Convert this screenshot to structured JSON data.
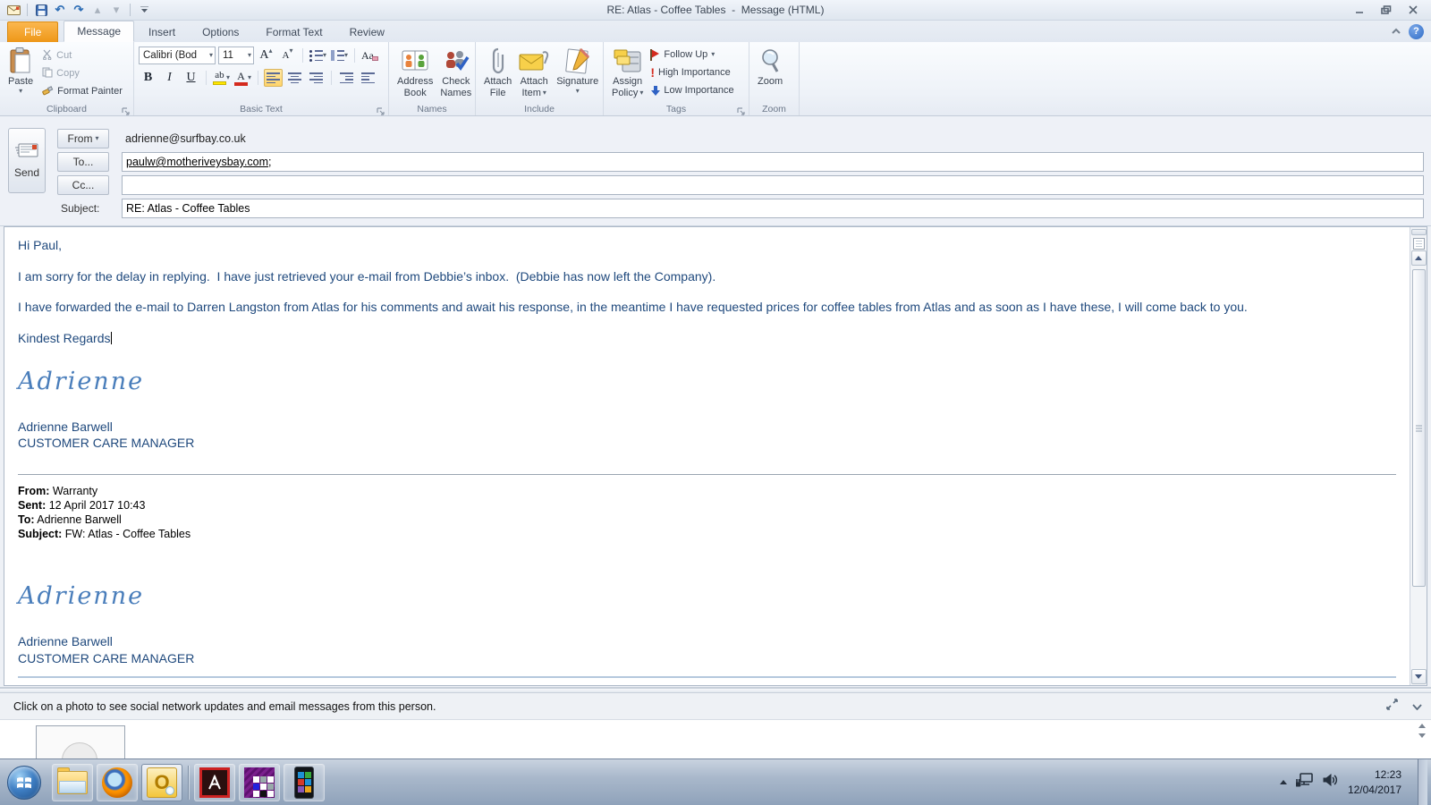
{
  "window": {
    "title": "RE: Atlas - Coffee Tables  -  Message (HTML)"
  },
  "tabs": {
    "file": "File",
    "items": [
      {
        "label": "Message",
        "active": true
      },
      {
        "label": "Insert",
        "active": false
      },
      {
        "label": "Options",
        "active": false
      },
      {
        "label": "Format Text",
        "active": false
      },
      {
        "label": "Review",
        "active": false
      }
    ]
  },
  "ribbon": {
    "clipboard": {
      "label": "Clipboard",
      "paste": "Paste",
      "cut": "Cut",
      "copy": "Copy",
      "format_painter": "Format Painter"
    },
    "basic_text": {
      "label": "Basic Text",
      "font_name": "Calibri (Bod",
      "font_size": "11"
    },
    "names": {
      "label": "Names",
      "address_book_1": "Address",
      "address_book_2": "Book",
      "check_names_1": "Check",
      "check_names_2": "Names"
    },
    "include": {
      "label": "Include",
      "attach_file_1": "Attach",
      "attach_file_2": "File",
      "attach_item_1": "Attach",
      "attach_item_2": "Item",
      "signature": "Signature"
    },
    "tags": {
      "label": "Tags",
      "assign_policy_1": "Assign",
      "assign_policy_2": "Policy",
      "follow_up": "Follow Up",
      "high_importance": "High Importance",
      "low_importance": "Low Importance"
    },
    "zoom": {
      "label": "Zoom",
      "zoom": "Zoom"
    }
  },
  "header": {
    "send": "Send",
    "from_label": "From",
    "from_value": "adrienne@surfbay.co.uk",
    "to_label": "To...",
    "to_value": "paulw@motheriveysbay.com",
    "to_suffix": ";",
    "cc_label": "Cc...",
    "cc_value": "",
    "subject_label": "Subject:",
    "subject_value": "RE: Atlas - Coffee Tables"
  },
  "body": {
    "greeting": "Hi Paul,",
    "p1": "I am sorry for the delay in replying.  I have just retrieved your e-mail from Debbie’s inbox.  (Debbie has now left the Company).",
    "p2": "I have forwarded the e-mail to Darren Langston from Atlas for his comments and await his response, in the meantime I have requested prices for coffee tables from Atlas and as soon as I have these, I will come back to you.",
    "closing": "Kindest Regards",
    "signature_script": "Adrienne",
    "signature_name": "Adrienne Barwell",
    "signature_role": "CUSTOMER CARE MANAGER",
    "quoted": {
      "from_label": "From:",
      "from": " Warranty",
      "sent_label": "Sent:",
      "sent": " 12 April 2017 10:43",
      "to_label": "To:",
      "to": " Adrienne Barwell",
      "subject_label": "Subject:",
      "subject": " FW: Atlas - Coffee Tables"
    }
  },
  "people_pane": {
    "hint": "Click on a photo to see social network updates and email messages from this person."
  },
  "taskbar": {
    "time": "12:23",
    "date": "12/04/2017"
  },
  "icons": {
    "caret": "▾",
    "undo": "↶",
    "redo": "↷",
    "nav_up": "▴",
    "nav_down": "▾",
    "bold": "B",
    "italic": "I",
    "underline": "U",
    "grow_font": "A",
    "shrink_font": "A",
    "clear_format": "Aa",
    "highlight": "ab",
    "font_color": "A",
    "high_importance_glyph": "!",
    "question": "?",
    "outlook_letter": "O"
  },
  "colors": {
    "accent_orange": "#ee9718",
    "body_blue": "#1f497d",
    "script_blue": "#4a7ebb",
    "highlight_yellow": "#ffe600",
    "font_color_red": "#d42a1e"
  }
}
